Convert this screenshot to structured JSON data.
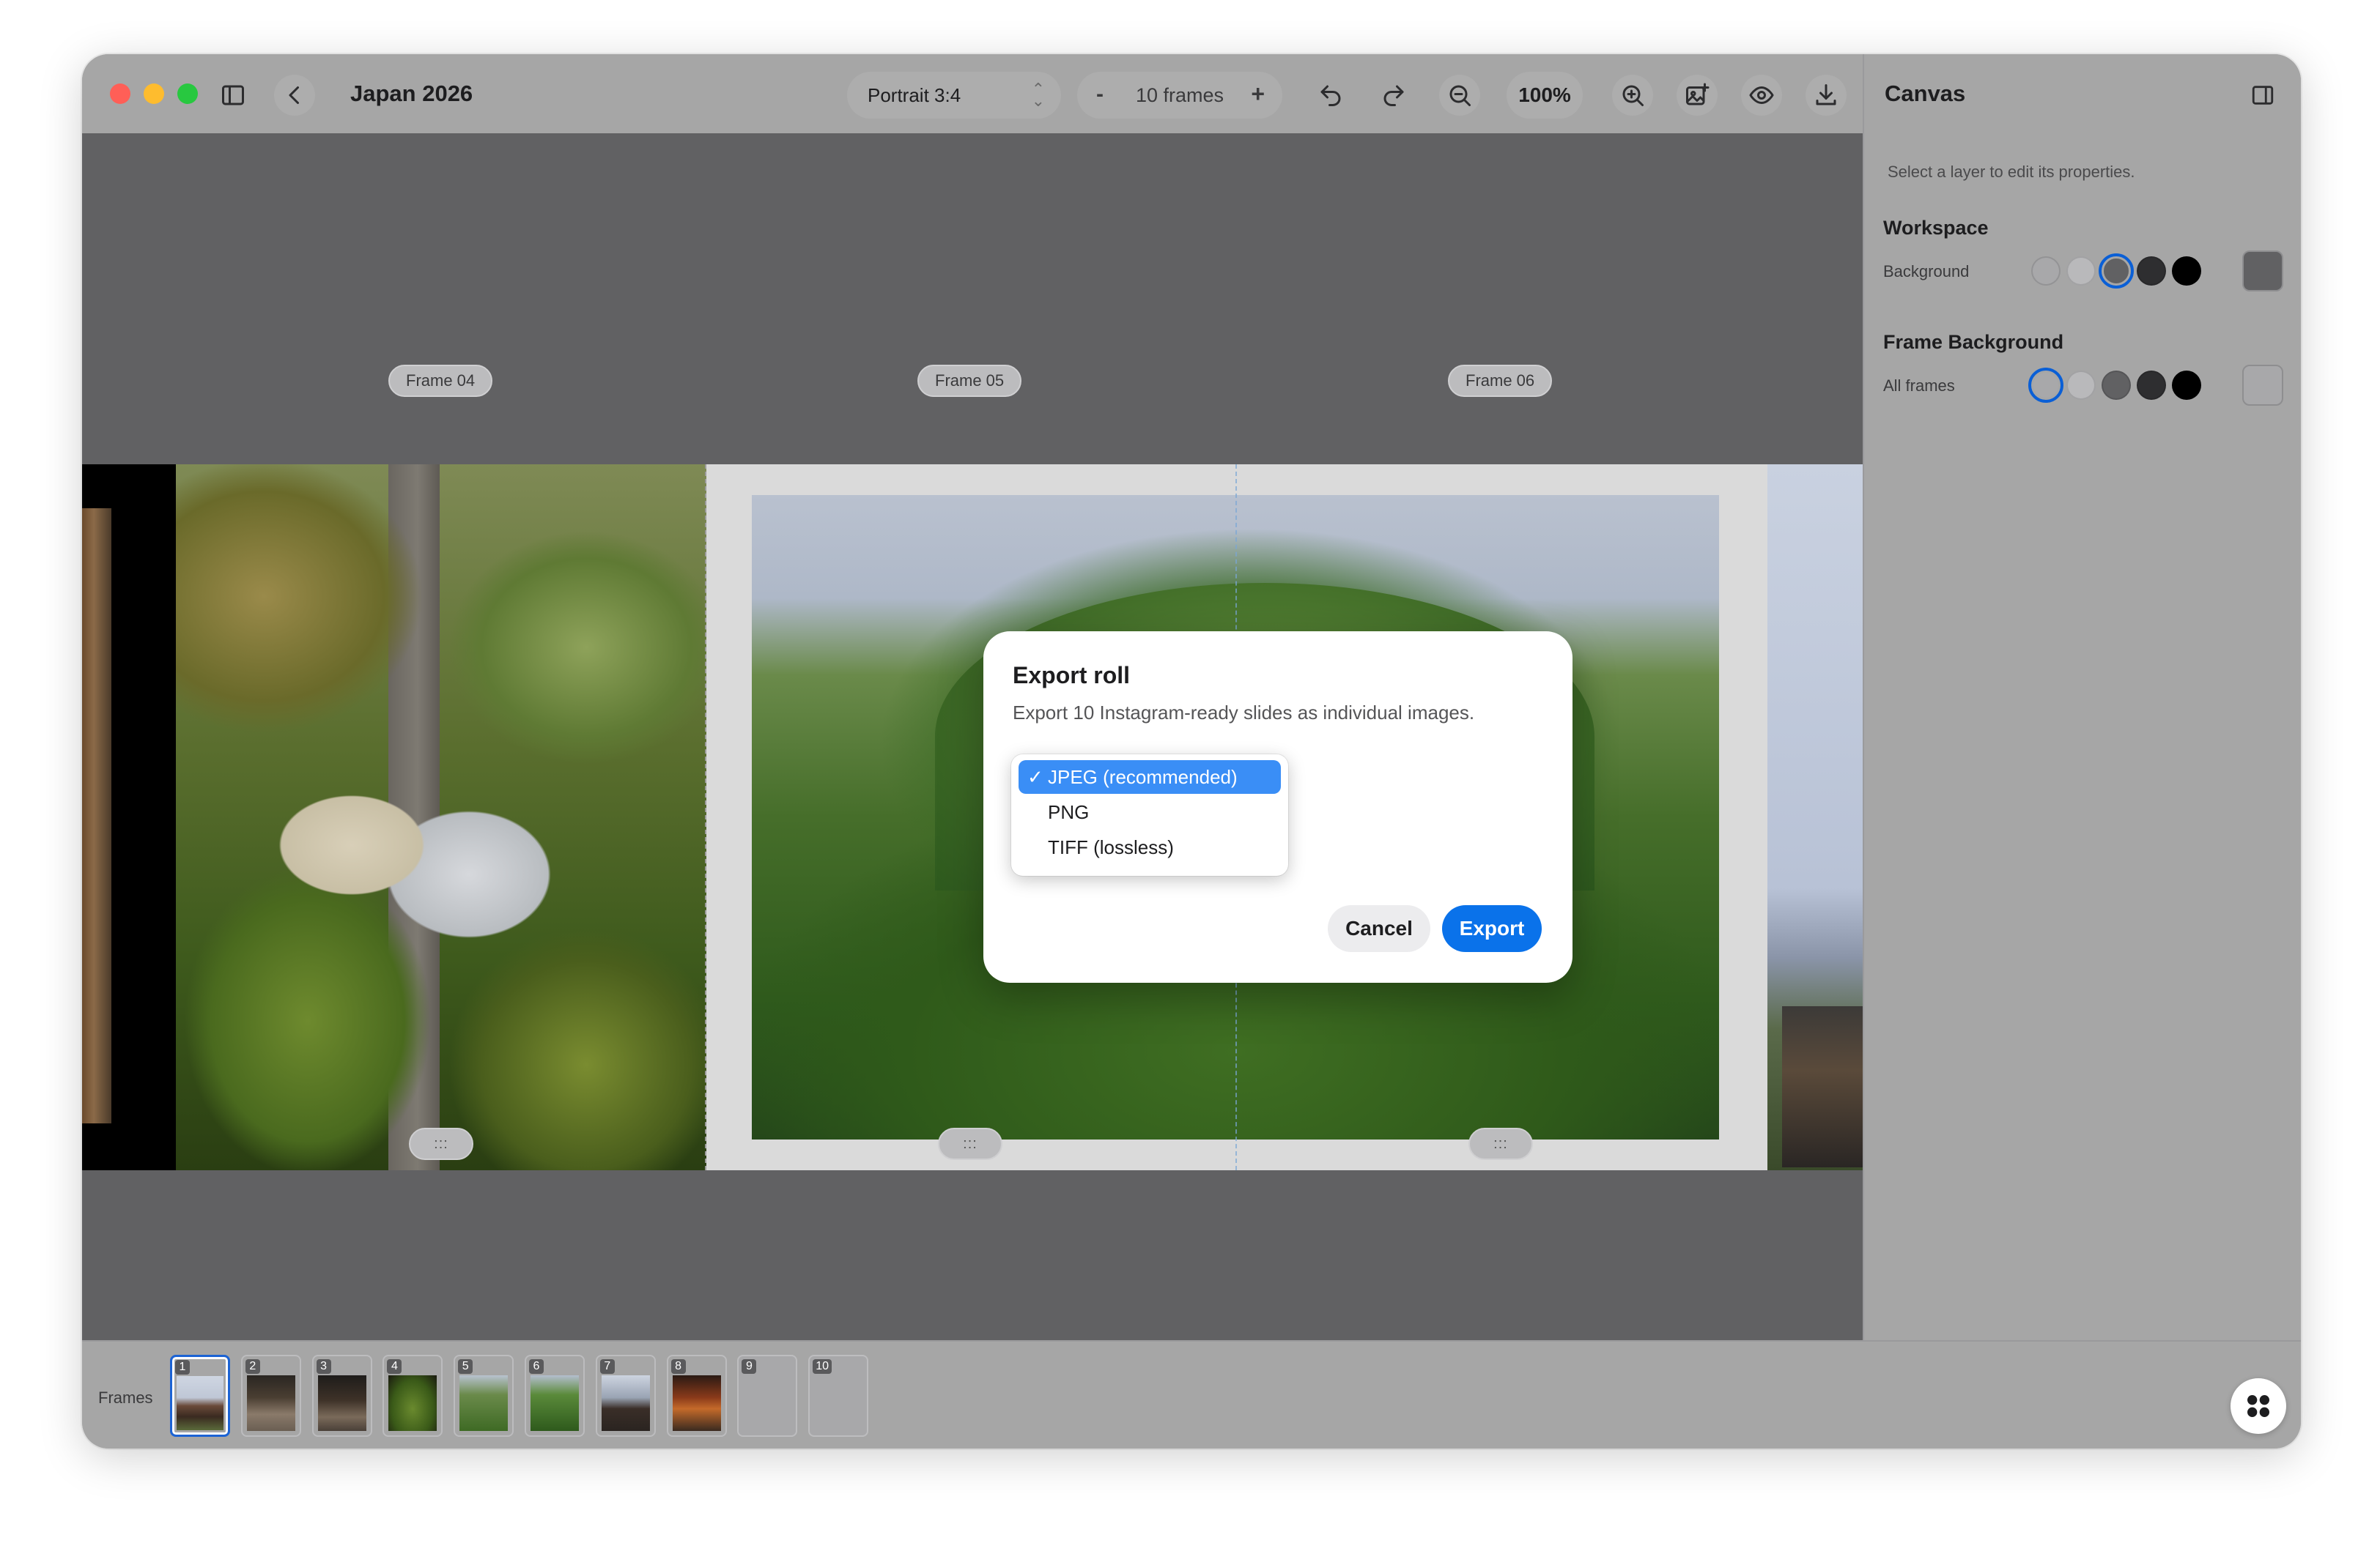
{
  "app": {
    "doc_title": "Japan 2026"
  },
  "toolbar": {
    "aspect_ratio": "Portrait 3:4",
    "frames_minus": "-",
    "frames_count_label": "10 frames",
    "frames_plus": "+",
    "zoom_level": "100%",
    "icons": [
      "sidebar-icon",
      "chevron-left-icon",
      "undo-icon",
      "redo-icon",
      "zoom-out-icon",
      "zoom-in-icon",
      "add-image-icon",
      "eye-icon",
      "download-icon"
    ]
  },
  "canvas": {
    "frame_tags": [
      "Frame 04",
      "Frame 05",
      "Frame 06"
    ],
    "handle_glyph": ":::"
  },
  "modal": {
    "title": "Export roll",
    "subtitle": "Export 10 Instagram-ready slides as individual images.",
    "format_options": [
      {
        "label": "JPEG (recommended)",
        "selected": true
      },
      {
        "label": "PNG",
        "selected": false
      },
      {
        "label": "TIFF (lossless)",
        "selected": false
      }
    ],
    "check_glyph": "✓",
    "cancel_label": "Cancel",
    "export_label": "Export"
  },
  "panel": {
    "title": "Canvas",
    "hint": "Select a layer to edit its properties.",
    "workspace": {
      "title": "Workspace",
      "label": "Background",
      "swatches": [
        "#a8a8aa",
        "#b9b9bb",
        "#616163",
        "#2e2e30",
        "#000000"
      ],
      "active_index": 2,
      "current_color": "#616163"
    },
    "frame_background": {
      "title": "Frame Background",
      "label": "All frames",
      "swatches": [
        "#a8a8aa",
        "#b9b9bb",
        "#616163",
        "#2e2e30",
        "#000000"
      ],
      "active_index": 0,
      "current_color": "#a8a8aa"
    }
  },
  "bottombar": {
    "frames_label": "Frames",
    "thumbnails": [
      "1",
      "2",
      "3",
      "4",
      "5",
      "6",
      "7",
      "8",
      "9",
      "10"
    ],
    "selected_index": 0
  },
  "colors": {
    "accent": "#0a72ea",
    "selection": "#3a8ef6",
    "window_bg": "#a6a6a6",
    "canvas_bg": "#616163"
  }
}
